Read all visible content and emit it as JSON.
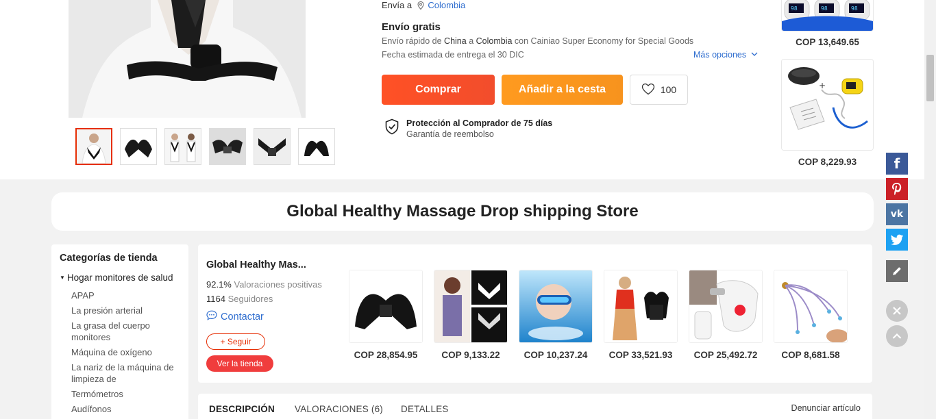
{
  "shipping": {
    "ship_to_label": "Envía a",
    "country": "Colombia",
    "free_shipping": "Envío gratis",
    "line1_prefix": "Envío rápido de ",
    "origin": "China",
    "line1_mid": " a ",
    "destination": "Colombia",
    "line1_suffix": " con Cainiao Super Economy for Special Goods",
    "estimated": "Fecha estimada de entrega el 30 DIC",
    "more_options": "Más opciones"
  },
  "actions": {
    "buy": "Comprar",
    "add_to_cart": "Añadir a la cesta",
    "wishlist_count": "100"
  },
  "protection": {
    "title": "Protección al Comprador de 75 días",
    "subtitle": "Garantía de reembolso"
  },
  "recommended": [
    {
      "price": "COP 13,649.65"
    },
    {
      "price": "COP 8,229.93"
    }
  ],
  "store": {
    "banner_title": "Global Healthy Massage Drop shipping Store",
    "name_short": "Global Healthy Mas...",
    "rating_value": "92.1%",
    "rating_label": " Valoraciones positivas",
    "followers_value": "1164",
    "followers_label": " Seguidores",
    "contact": "Contactar",
    "follow": "+ Seguir",
    "visit": "Ver la tienda",
    "products": [
      {
        "price": "COP 28,854.95"
      },
      {
        "price": "COP 9,133.22"
      },
      {
        "price": "COP 10,237.24"
      },
      {
        "price": "COP 33,521.93"
      },
      {
        "price": "COP 25,492.72"
      },
      {
        "price": "COP 8,681.58"
      }
    ]
  },
  "categories": {
    "title": "Categorías de tienda",
    "parent": "Hogar monitores de salud",
    "items": [
      "APAP",
      "La presión arterial",
      "La grasa del cuerpo monitores",
      "Máquina de oxígeno",
      "La nariz de la máquina de limpieza de",
      "Termómetros",
      "Audífonos"
    ]
  },
  "tabs": {
    "description": "DESCRIPCIÓN",
    "reviews": "VALORACIONES (6)",
    "details": "DETALLES",
    "report": "Denunciar artículo"
  },
  "colors": {
    "buy": "#ff5125",
    "cart": "#f7931e",
    "link": "#2e6dcf",
    "facebook": "#3b5998",
    "pinterest": "#cb2027",
    "vk": "#4c75a3",
    "twitter": "#1da1f2",
    "edit": "#6d6d6d"
  }
}
